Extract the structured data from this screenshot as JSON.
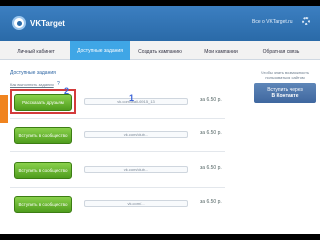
{
  "header": {
    "logo_text": "VKTarget",
    "user_link": "Все о VKTarget.ru"
  },
  "tabs": [
    {
      "label": "Личный кабинет",
      "active": false
    },
    {
      "label": "Доступные задания",
      "active": true
    },
    {
      "label": "Создать кампанию",
      "active": false
    },
    {
      "label": "Мои кампании",
      "active": false
    },
    {
      "label": "Обратная связь",
      "active": false
    }
  ],
  "section": {
    "title": "Доступные задания",
    "hint": "Как выполнять задания",
    "help_icon": "?"
  },
  "tasks": [
    {
      "button": "Рассказать друзьям",
      "link": "vk.com/wall-6915_13",
      "price": "за 6.50 р."
    },
    {
      "button": "Вступить в сообщество",
      "link": "vk.com/club...",
      "price": "за 6.50 р."
    },
    {
      "button": "Вступить в сообщество",
      "link": "vk.com/club...",
      "price": "за 6.50 р."
    },
    {
      "button": "Вступить в сообщество",
      "link": "vk.com/...",
      "price": "за 6.50 р."
    }
  ],
  "annotations": {
    "one": "1",
    "two": "2"
  },
  "promo": {
    "text": "Чтобы знать возможность пользоваться сайтом",
    "button_line1": "Вступить через",
    "button_line2": "В Контакте"
  },
  "colors": {
    "header": "#2a6aa8",
    "tab_active": "#3fa6e6",
    "button_green": "#4f9d1d",
    "highlight": "#d33b3b"
  }
}
